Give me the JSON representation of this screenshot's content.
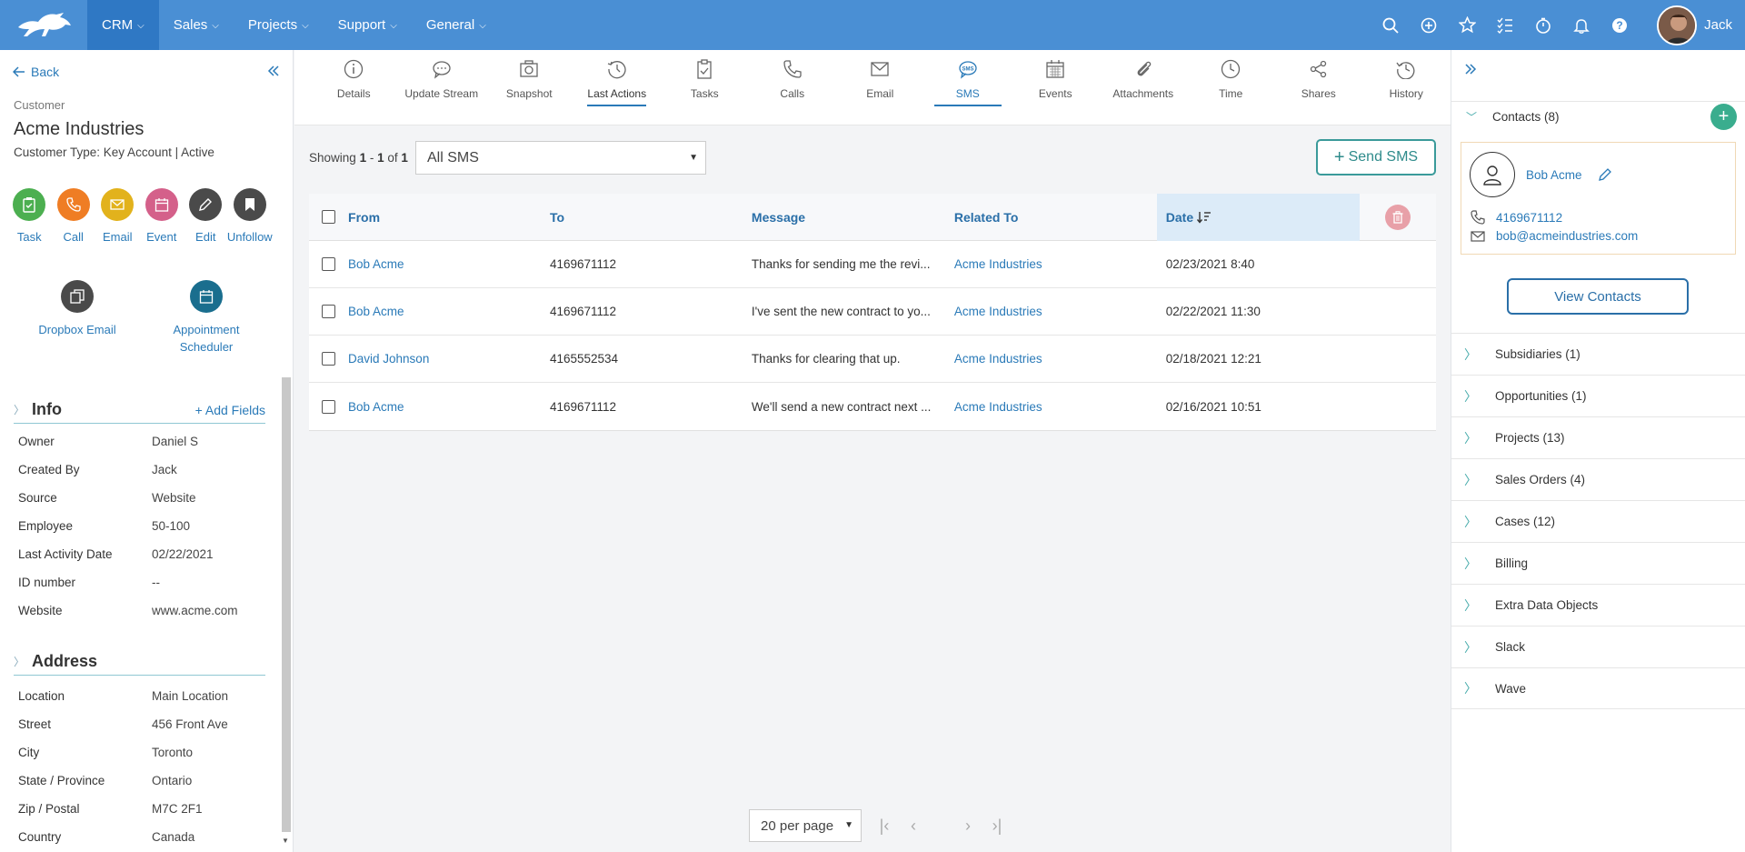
{
  "nav": {
    "items": [
      {
        "label": "CRM",
        "active": true
      },
      {
        "label": "Sales",
        "active": false
      },
      {
        "label": "Projects",
        "active": false
      },
      {
        "label": "Support",
        "active": false
      },
      {
        "label": "General",
        "active": false
      }
    ],
    "user_name": "Jack"
  },
  "left": {
    "back_label": "Back",
    "entity_type": "Customer",
    "name": "Acme Industries",
    "customer_type": "Customer Type: Key Account | Active",
    "actions": [
      {
        "label": "Task",
        "color": "#4caf50",
        "icon": "task-icon"
      },
      {
        "label": "Call",
        "color": "#ef7d24",
        "icon": "phone-icon"
      },
      {
        "label": "Email",
        "color": "#e2b21c",
        "icon": "email-icon"
      },
      {
        "label": "Event",
        "color": "#d4608a",
        "icon": "calendar-icon"
      },
      {
        "label": "Edit",
        "color": "#4a4a4a",
        "icon": "pencil-icon"
      },
      {
        "label": "Unfollow",
        "color": "#4a4a4a",
        "icon": "bookmark-icon"
      }
    ],
    "actions2": [
      {
        "label": "Dropbox Email",
        "color": "#4a4a4a",
        "icon": "copy-icon"
      },
      {
        "label": "Appointment Scheduler",
        "color": "#1a6e8e",
        "icon": "calendar-icon"
      }
    ],
    "info": {
      "title": "Info",
      "add_label": "+ Add Fields",
      "fields": [
        {
          "key": "Owner",
          "value": "Daniel S"
        },
        {
          "key": "Created By",
          "value": "Jack"
        },
        {
          "key": "Source",
          "value": "Website"
        },
        {
          "key": "Employee",
          "value": "50-100"
        },
        {
          "key": "Last Activity Date",
          "value": "02/22/2021"
        },
        {
          "key": "ID number",
          "value": "--"
        },
        {
          "key": "Website",
          "value": "www.acme.com"
        }
      ]
    },
    "address": {
      "title": "Address",
      "fields": [
        {
          "key": "Location",
          "value": "Main Location"
        },
        {
          "key": "Street",
          "value": "456 Front Ave"
        },
        {
          "key": "City",
          "value": "Toronto"
        },
        {
          "key": "State / Province",
          "value": "Ontario"
        },
        {
          "key": "Zip / Postal",
          "value": "M7C 2F1"
        },
        {
          "key": "Country",
          "value": "Canada"
        }
      ]
    }
  },
  "tabs": [
    {
      "label": "Details",
      "icon": "info-icon"
    },
    {
      "label": "Update Stream",
      "icon": "chat-icon"
    },
    {
      "label": "Snapshot",
      "icon": "camera-icon"
    },
    {
      "label": "Last Actions",
      "icon": "clock-icon"
    },
    {
      "label": "Tasks",
      "icon": "clipboard-icon"
    },
    {
      "label": "Calls",
      "icon": "phone-icon"
    },
    {
      "label": "Email",
      "icon": "email-icon"
    },
    {
      "label": "SMS",
      "icon": "sms-icon",
      "active": true
    },
    {
      "label": "Events",
      "icon": "calendar-icon"
    },
    {
      "label": "Attachments",
      "icon": "paperclip-icon"
    },
    {
      "label": "Time",
      "icon": "clock-icon"
    },
    {
      "label": "Shares",
      "icon": "share-icon"
    },
    {
      "label": "History",
      "icon": "history-icon"
    }
  ],
  "sms": {
    "showing_prefix": "Showing",
    "range_start": "1",
    "range_sep": "-",
    "range_end": "1",
    "of_label": "of",
    "total": "1",
    "filter_value": "All SMS",
    "send_label": "Send SMS",
    "columns": {
      "from": "From",
      "to": "To",
      "message": "Message",
      "related": "Related To",
      "date": "Date"
    },
    "rows": [
      {
        "from": "Bob Acme",
        "to": "4169671112",
        "message": "Thanks for sending me the revi...",
        "related": "Acme Industries",
        "date": "02/23/2021 8:40"
      },
      {
        "from": "Bob Acme",
        "to": "4169671112",
        "message": "I've sent the new contract to yo...",
        "related": "Acme Industries",
        "date": "02/22/2021 11:30"
      },
      {
        "from": "David Johnson",
        "to": "4165552534",
        "message": "Thanks for clearing that up.",
        "related": "Acme Industries",
        "date": "02/18/2021 12:21"
      },
      {
        "from": "Bob Acme",
        "to": "4169671112",
        "message": "We'll send a new contract next ...",
        "related": "Acme Industries",
        "date": "02/16/2021 10:51"
      }
    ],
    "per_page": "20 per page"
  },
  "right": {
    "contacts_title": "Contacts (8)",
    "contact": {
      "name": "Bob Acme",
      "phone": "4169671112",
      "email": "bob@acmeindustries.com"
    },
    "view_contacts_label": "View Contacts",
    "sections": [
      "Subsidiaries (1)",
      "Opportunities (1)",
      "Projects (13)",
      "Sales Orders (4)",
      "Cases (12)",
      "Billing",
      "Extra Data Objects",
      "Slack",
      "Wave"
    ]
  },
  "colors": {
    "topbar": "#4a8fd4",
    "accent": "#2a7ab8",
    "send_sms": "#3a9a9a",
    "add_contact": "#3aad8e"
  }
}
